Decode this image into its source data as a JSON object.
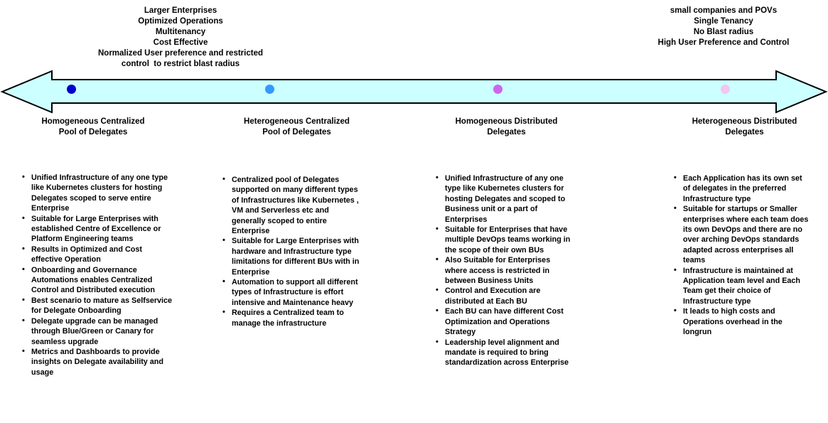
{
  "top_notes": {
    "left": {
      "lines": [
        "Larger Enterprises",
        "Optimized Operations",
        "Multitenancy",
        "Cost Effective",
        "Normalized User preference and restricted",
        "control  to restrict blast radius"
      ]
    },
    "right": {
      "lines": [
        "small companies and POVs",
        "Single Tenancy",
        "No Blast radius",
        "High User Preference and Control"
      ]
    }
  },
  "arrow": {
    "name": "spectrum-double-arrow",
    "fill_color": "#CCFFFF",
    "stroke_color": "#000000",
    "direction": "double-headed"
  },
  "markers": [
    {
      "label": "marker-1",
      "color": "#0000CC",
      "x_percent": 8.6
    },
    {
      "label": "marker-2",
      "color": "#3399FF",
      "x_percent": 32.6
    },
    {
      "label": "marker-3",
      "color": "#CC66EE",
      "x_percent": 60.1
    },
    {
      "label": "marker-4",
      "color": "#F2C6F2",
      "x_percent": 87.6
    }
  ],
  "columns": [
    {
      "title": "Homogeneous Centralized\nPool of Delegates",
      "bullets": [
        "Unified Infrastructure of any one type like Kubernetes clusters for hosting Delegates scoped to serve entire Enterprise",
        "Suitable for Large Enterprises with established  Centre of Excellence or Platform Engineering teams",
        "Results in Optimized and Cost effective Operation",
        "Onboarding and Governance Automations enables Centralized Control and Distributed execution",
        "Best scenario to mature as Selfservice for Delegate Onboarding",
        "Delegate upgrade can be managed through Blue/Green or Canary for seamless upgrade",
        "Metrics and Dashboards to provide insights on Delegate availability and usage"
      ]
    },
    {
      "title": "Heterogeneous Centralized\nPool of Delegates",
      "bullets": [
        "Centralized pool of Delegates supported on many different types of Infrastructures like Kubernetes , VM and Serverless etc and generally scoped to entire Enterprise",
        "Suitable for Large Enterprises with hardware and Infrastructure type limitations for different BUs with in Enterprise",
        "Automation to support all different types of Infrastructure is effort intensive and Maintenance heavy",
        "Requires a Centralized team to manage the infrastructure"
      ]
    },
    {
      "title": "Homogeneous Distributed\nDelegates",
      "bullets": [
        "Unified Infrastructure of any one type like Kubernetes clusters for hosting Delegates and scoped to Business unit or a part of Enterprises",
        "Suitable for Enterprises that have multiple DevOps teams working in the scope of their own BUs",
        "Also Suitable for Enterprises where access is restricted in between Business Units",
        "Control and Execution are distributed at Each BU",
        "Each BU can have different Cost Optimization and Operations Strategy",
        "Leadership level alignment and mandate is required to bring standardization across Enterprise"
      ]
    },
    {
      "title": "Heterogeneous Distributed\nDelegates",
      "bullets": [
        "Each Application has its own set of delegates in the preferred Infrastructure type",
        "Suitable for startups or Smaller enterprises where each team does its own DevOps and there are no over arching DevOps standards adapted across enterprises  all teams",
        "Infrastructure is maintained at Application team level and Each Team get their choice of Infrastructure type",
        " It leads to high costs and Operations overhead in the longrun"
      ]
    }
  ]
}
